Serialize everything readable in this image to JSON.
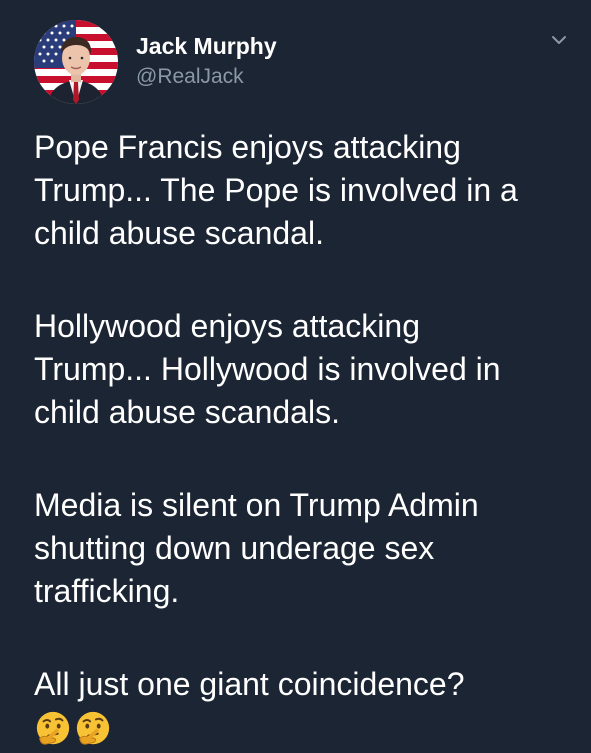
{
  "tweet": {
    "display_name": "Jack Murphy",
    "handle": "@RealJack",
    "paragraphs": [
      "Pope Francis enjoys attacking\nTrump... The Pope is involved in a\nchild abuse scandal.",
      "Hollywood enjoys attacking\nTrump... Hollywood is involved in\nchild abuse scandals.",
      "Media is silent on Trump Admin\nshutting down underage sex\ntrafficking.",
      "All just one giant coincidence?"
    ],
    "emojis": [
      "thinking-face-emoji",
      "thinking-face-emoji"
    ],
    "menu_icon": "chevron-down-icon"
  },
  "colors": {
    "background": "#1c2533",
    "text": "#ffffff",
    "secondary_text": "#8b98a5"
  }
}
